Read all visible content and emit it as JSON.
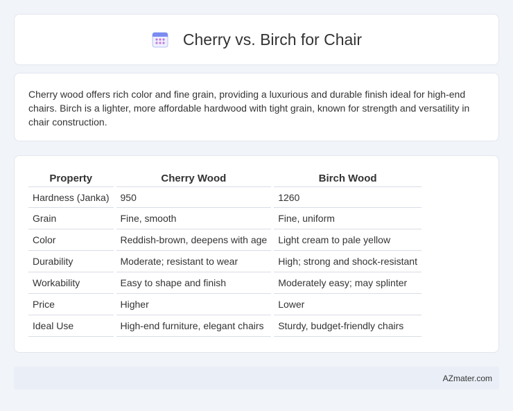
{
  "header": {
    "title": "Cherry vs. Birch for Chair",
    "icon": "calendar-icon",
    "accent_color": "#7b8cf0"
  },
  "intro": {
    "text": "Cherry wood offers rich color and fine grain, providing a luxurious and durable finish ideal for high-end chairs. Birch is a lighter, more affordable hardwood with tight grain, known for strength and versatility in chair construction."
  },
  "table": {
    "headers": [
      "Property",
      "Cherry Wood",
      "Birch Wood"
    ],
    "rows": [
      [
        "Hardness (Janka)",
        "950",
        "1260"
      ],
      [
        "Grain",
        "Fine, smooth",
        "Fine, uniform"
      ],
      [
        "Color",
        "Reddish-brown, deepens with age",
        "Light cream to pale yellow"
      ],
      [
        "Durability",
        "Moderate; resistant to wear",
        "High; strong and shock-resistant"
      ],
      [
        "Workability",
        "Easy to shape and finish",
        "Moderately easy; may splinter"
      ],
      [
        "Price",
        "Higher",
        "Lower"
      ],
      [
        "Ideal Use",
        "High-end furniture, elegant chairs",
        "Sturdy, budget-friendly chairs"
      ]
    ]
  },
  "footer": {
    "brand": "AZmater.com"
  }
}
